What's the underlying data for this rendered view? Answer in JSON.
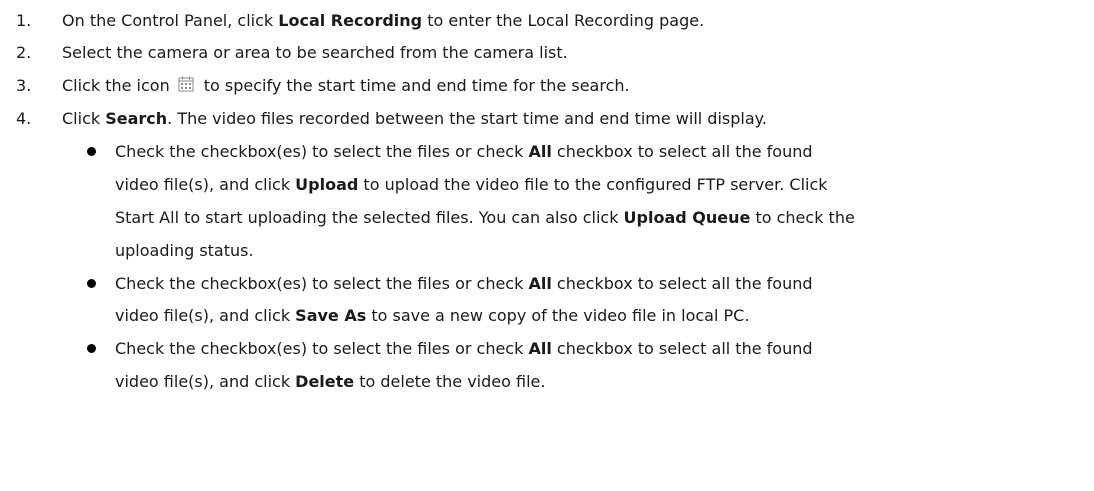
{
  "steps": [
    {
      "num": "1.",
      "pre": "On the Control Panel, click ",
      "bold": "Local Recording",
      "post": " to enter the Local Recording page."
    },
    {
      "num": "2.",
      "text": "Select the camera or area to be searched from the camera list."
    },
    {
      "num": "3.",
      "pre": "Click the icon",
      "post": "to specify the start time and end time for the search.",
      "icon": "calendar-icon"
    },
    {
      "num": "4.",
      "pre": "Click ",
      "bold": "Search",
      "post": ". The video files recorded between the start time and end time will display."
    }
  ],
  "bullets": [
    {
      "l1_pre": "Check the checkbox(es) to select the files or check ",
      "l1_bold": "All",
      "l1_post": " checkbox to select all the found",
      "l2_pre": "video file(s), and click ",
      "l2_bold": "Upload",
      "l2_post": " to upload the video file to the configured FTP server. Click",
      "l3_pre": "Start All to start uploading the selected files. You can also click ",
      "l3_bold": "Upload Queue",
      "l3_post": " to check the",
      "l4": "uploading status."
    },
    {
      "l1_pre": "Check the checkbox(es) to select the files or check ",
      "l1_bold": "All",
      "l1_post": " checkbox to select all the found",
      "l2_pre": "video file(s), and click ",
      "l2_bold": "Save As",
      "l2_post": " to save a new copy of the video file in local PC."
    },
    {
      "l1_pre": "Check the checkbox(es) to select the files or check ",
      "l1_bold": "All",
      "l1_post": " checkbox to select all the found",
      "l2_pre": "video file(s), and click ",
      "l2_bold": "Delete",
      "l2_post": " to delete the video file."
    }
  ],
  "colors": {
    "text": "#1a1a1a",
    "icon_border": "#8a8a8a"
  }
}
